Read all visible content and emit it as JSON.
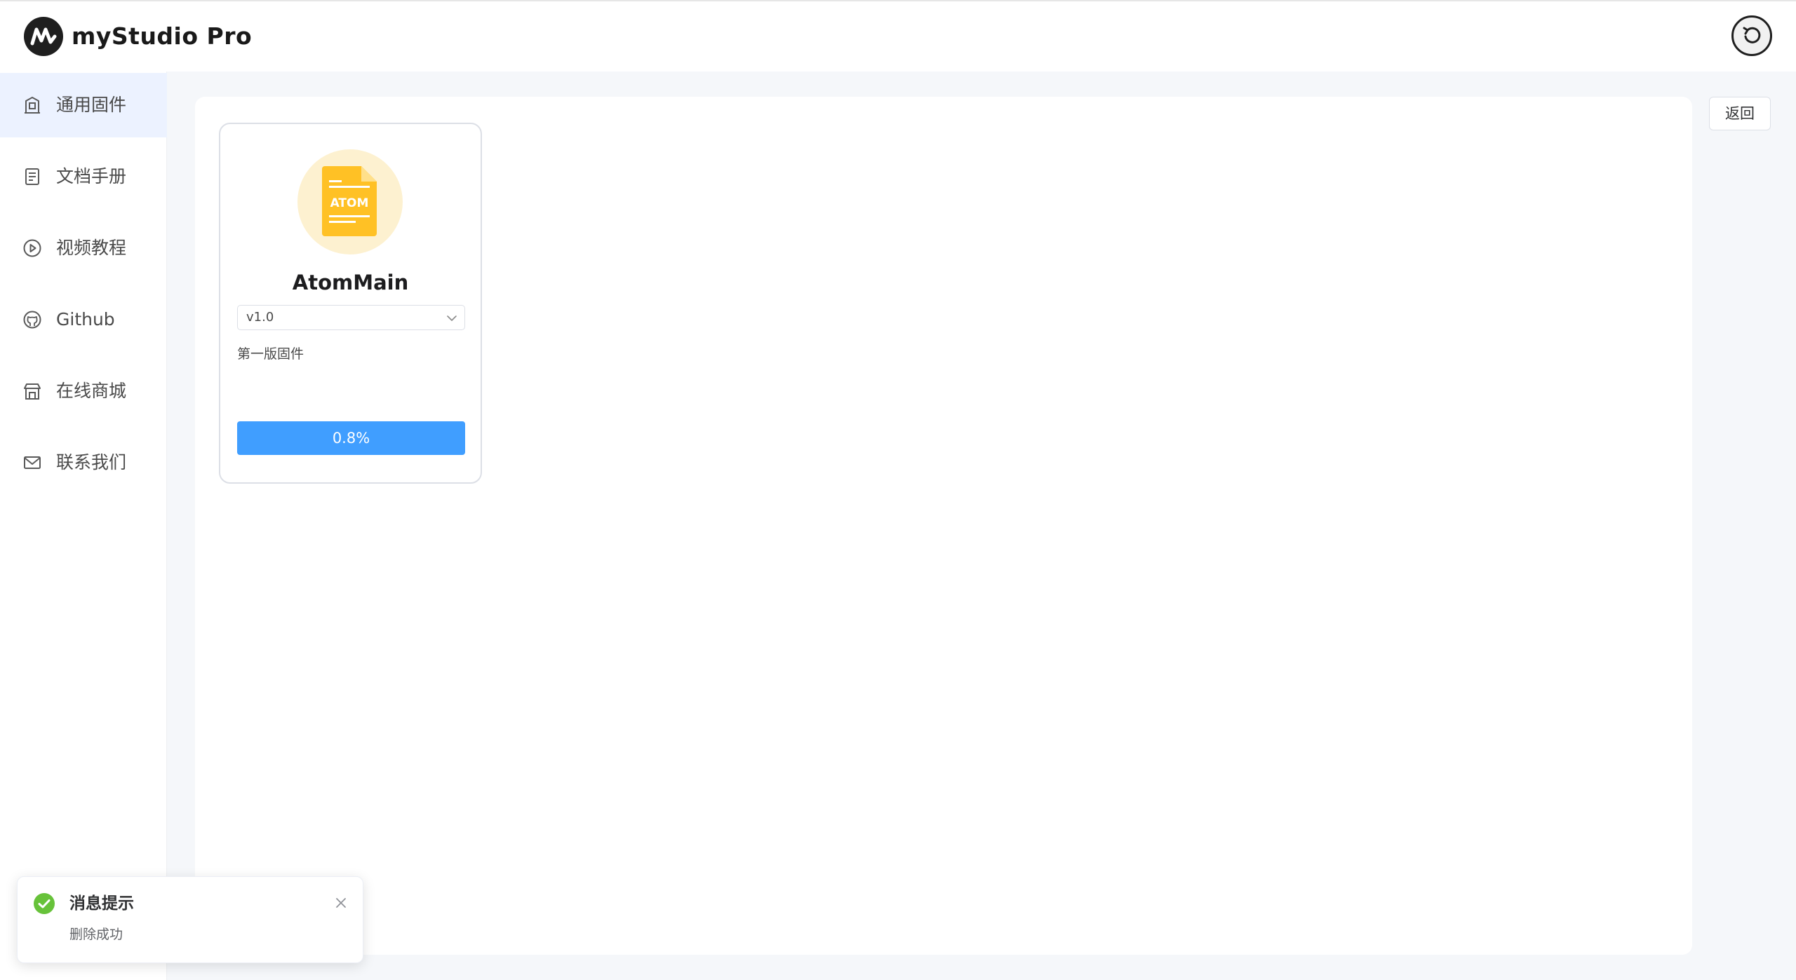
{
  "app": {
    "title": "myStudio Pro",
    "logo_icon": "mystudio-logo-icon"
  },
  "header": {
    "refresh_icon": "refresh-icon"
  },
  "sidebar": {
    "items": [
      {
        "label": "通用固件",
        "icon": "firmware-icon",
        "active": true
      },
      {
        "label": "文档手册",
        "icon": "document-icon",
        "active": false
      },
      {
        "label": "视频教程",
        "icon": "play-icon",
        "active": false
      },
      {
        "label": "Github",
        "icon": "github-icon",
        "active": false
      },
      {
        "label": "在线商城",
        "icon": "store-icon",
        "active": false
      },
      {
        "label": "联系我们",
        "icon": "mail-icon",
        "active": false
      }
    ]
  },
  "main": {
    "back_label": "返回",
    "firmware_cards": [
      {
        "icon_text": "ATOM",
        "name": "AtomMain",
        "version": "v1.0",
        "description": "第一版固件",
        "progress_label": "0.8%",
        "progress": 0.008
      }
    ]
  },
  "notification": {
    "title": "消息提示",
    "message": "删除成功",
    "type": "success"
  },
  "colors": {
    "accent": "#409eff",
    "active_nav_bg": "#ecf2ff",
    "success": "#67c23a",
    "firmware_icon": "#ffc125",
    "firmware_icon_bg": "#fdf1d0"
  }
}
